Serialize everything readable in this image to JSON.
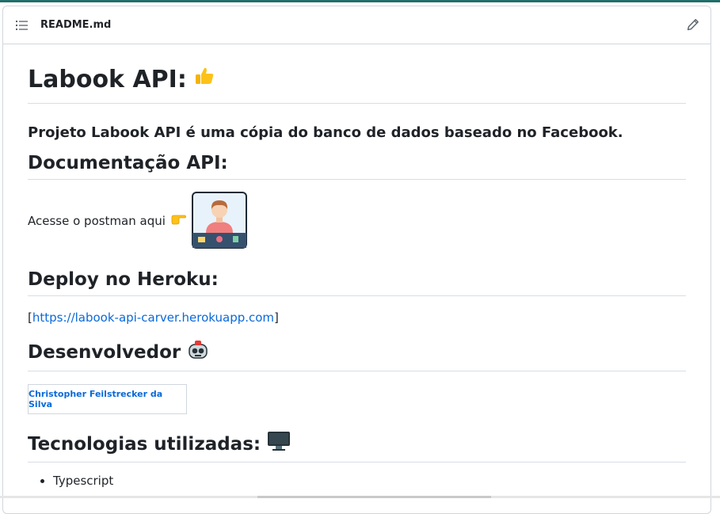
{
  "header": {
    "filename": "README.md"
  },
  "icons": {
    "list": "list-icon",
    "edit": "pencil-icon"
  },
  "content": {
    "title": "Labook API:",
    "subtitle": "Projeto Labook API é uma cópia do banco de dados baseado no Facebook.",
    "documentation": {
      "heading": "Documentação API:",
      "text": "Acesse o postman aqui"
    },
    "deploy": {
      "heading": "Deploy no Heroku:",
      "bracket_open": "[",
      "link": "https://labook-api-carver.herokuapp.com",
      "bracket_close": "]"
    },
    "developer": {
      "heading": "Desenvolvedor",
      "name": "Christopher Feilstrecker da Silva"
    },
    "technologies": {
      "heading": "Tecnologias utilizadas:",
      "items": [
        "Typescript"
      ]
    }
  },
  "colors": {
    "link": "#0969da",
    "border": "#d0d7de",
    "text": "#1f2328"
  }
}
